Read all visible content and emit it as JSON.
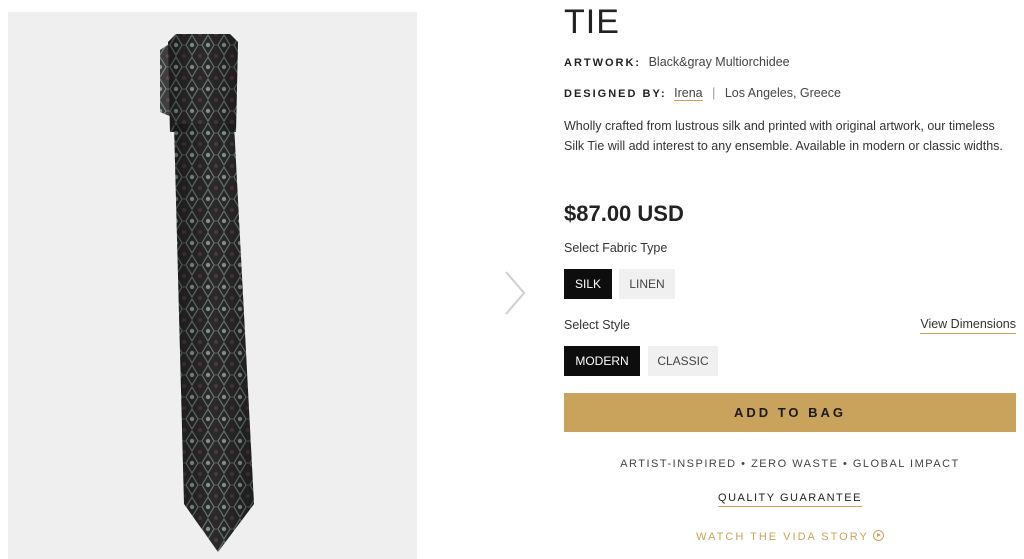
{
  "product": {
    "title": "TIE",
    "artwork_label": "ARTWORK:",
    "artwork_value": "Black&gray Multiorchidee",
    "designer_label": "DESIGNED BY:",
    "designer_name": "Irena",
    "separator": "|",
    "designer_location": "Los Angeles, Greece",
    "description": "Wholly crafted from lustrous silk and printed with original artwork, our timeless Silk Tie will add interest to any ensemble. Available in modern or classic widths.",
    "price": "$87.00 USD"
  },
  "fabric": {
    "label": "Select Fabric Type",
    "options": [
      "SILK",
      "LINEN"
    ],
    "selected": "SILK"
  },
  "style": {
    "label": "Select Style",
    "view_dimensions": "View Dimensions",
    "options": [
      "MODERN",
      "CLASSIC"
    ],
    "selected": "MODERN"
  },
  "actions": {
    "add_to_bag": "ADD TO BAG",
    "tagline": "ARTIST-INSPIRED  •  ZERO WASTE  •  GLOBAL IMPACT",
    "quality_guarantee": "QUALITY GUARANTEE",
    "watch_story": "WATCH THE VIDA STORY"
  },
  "gallery": {
    "image_name": "tie-product-image",
    "next_icon": "chevron-right-icon"
  },
  "colors": {
    "accent": "#c9a35c",
    "active_option": "#0d0d0d",
    "tie_base": "#2b2b2b",
    "panel_bg": "#efefef"
  }
}
